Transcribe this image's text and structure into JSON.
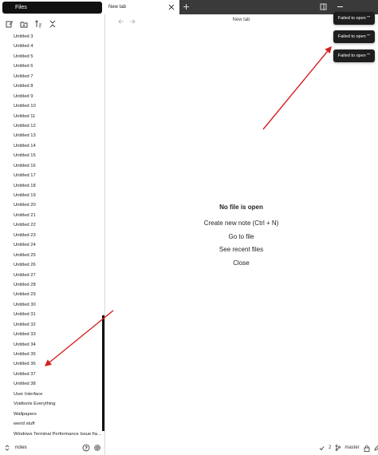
{
  "sidebar": {
    "tab_label": "Files",
    "toolbar": [
      {
        "icon": "new-note-icon"
      },
      {
        "icon": "new-folder-icon"
      },
      {
        "icon": "sort-icon"
      },
      {
        "icon": "collapse-icon"
      }
    ],
    "files": [
      "Untitled 3",
      "Untitled 4",
      "Untitled 5",
      "Untitled 6",
      "Untitled 7",
      "Untitled 8",
      "Untitled 9",
      "Untitled 10",
      "Untitled 11",
      "Untitled 12",
      "Untitled 13",
      "Untitled 14",
      "Untitled 15",
      "Untitled 16",
      "Untitled 17",
      "Untitled 18",
      "Untitled 19",
      "Untitled 20",
      "Untitled 21",
      "Untitled 22",
      "Untitled 23",
      "Untitled 24",
      "Untitled 25",
      "Untitled 26",
      "Untitled 27",
      "Untitled 28",
      "Untitled 29",
      "Untitled 30",
      "Untitled 31",
      "Untitled 32",
      "Untitled 33",
      "Untitled 34",
      "Untitled 35",
      "Untitled 36",
      "Untitled 37",
      "Untitled 38",
      "User Interface",
      "Voidtools Everything",
      "Wallpapers",
      "weird stuff",
      "Windows Terminal Performance Issue fia..."
    ],
    "vault_name": "notes"
  },
  "tabs": {
    "active_label": "New tab"
  },
  "view": {
    "title": "New tab"
  },
  "notices": [
    "Failed to open \"\"",
    "Failed to open \"\"",
    "Failed to open \"\""
  ],
  "empty_state": {
    "title": "No file is open",
    "actions": [
      "Create new note (Ctrl + N)",
      "Go to file",
      "See recent files",
      "Close"
    ]
  },
  "status_bar": {
    "sync_count": "2",
    "branch": "master"
  },
  "colors": {
    "accent_dark": "#111111",
    "tabbar_dark": "#3a3a3a",
    "notice_bg": "#1e1e1e",
    "annotation_arrow": "#d62020"
  }
}
